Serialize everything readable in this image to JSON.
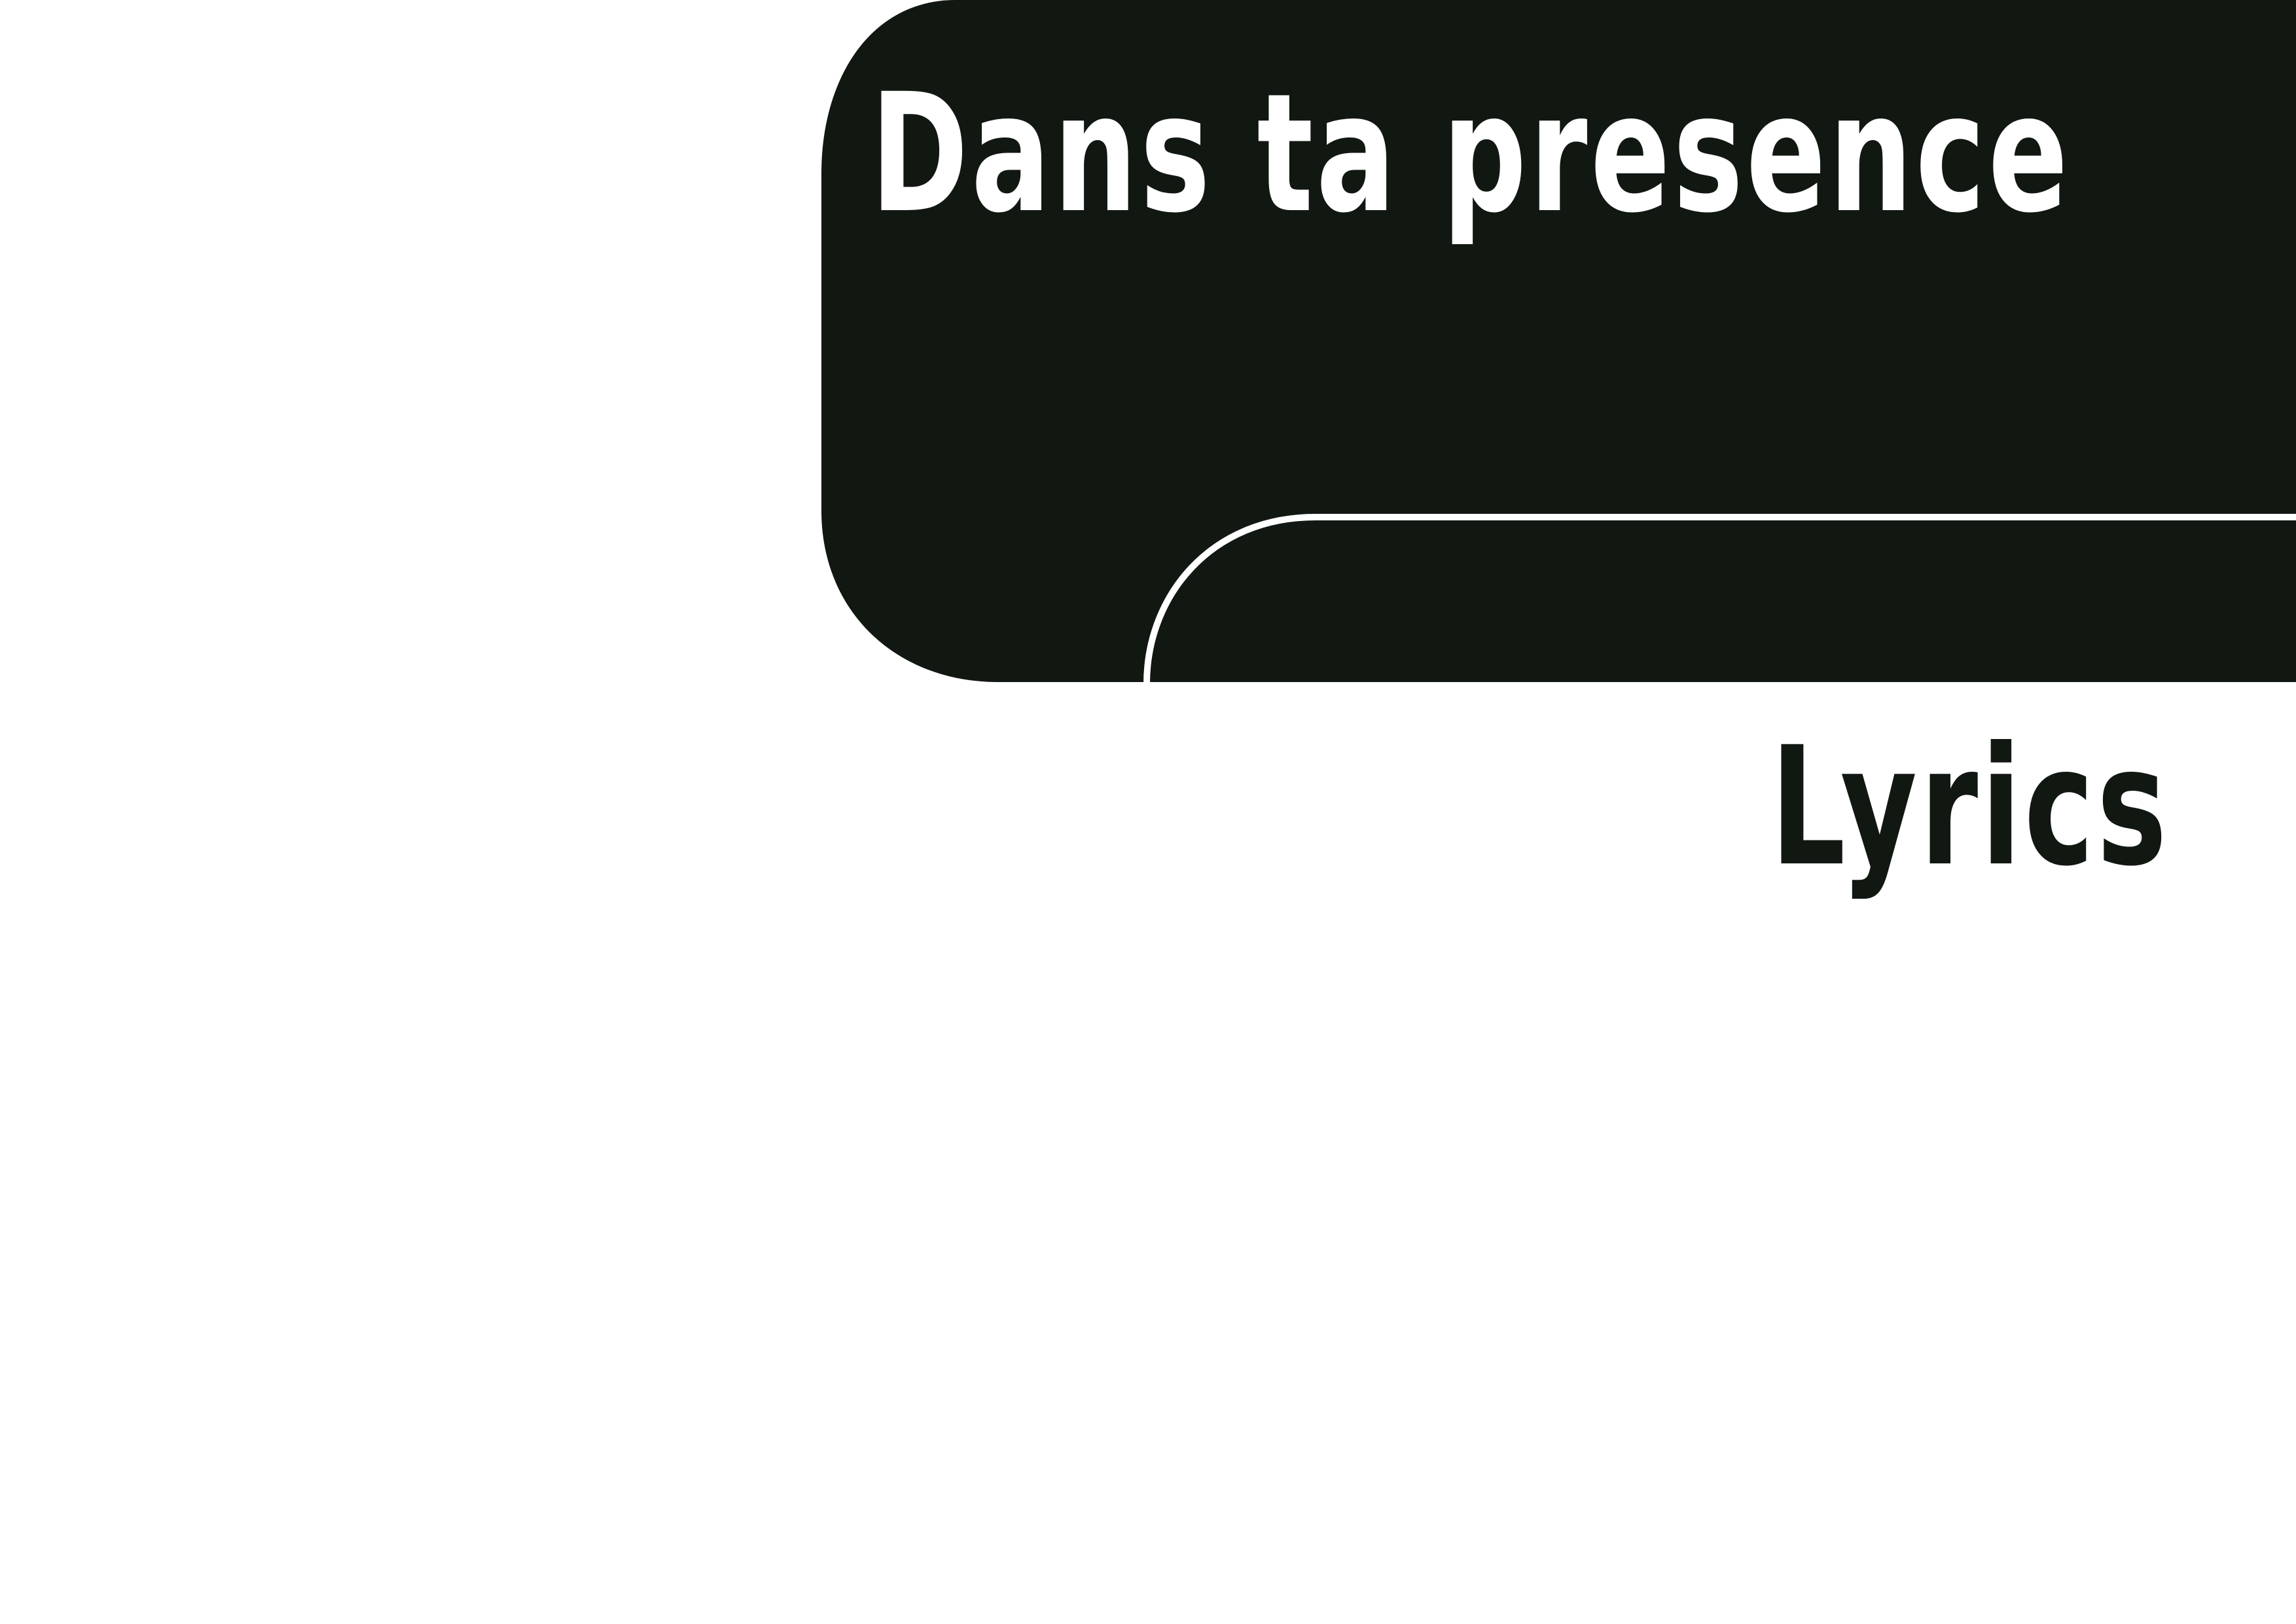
{
  "document": {
    "title": "Dans ta presence",
    "subtitle": "Lyrics"
  },
  "colors": {
    "panel": "#111711",
    "background": "#ffffff",
    "title_text": "#ffffff",
    "subtitle_text": "#111711"
  }
}
